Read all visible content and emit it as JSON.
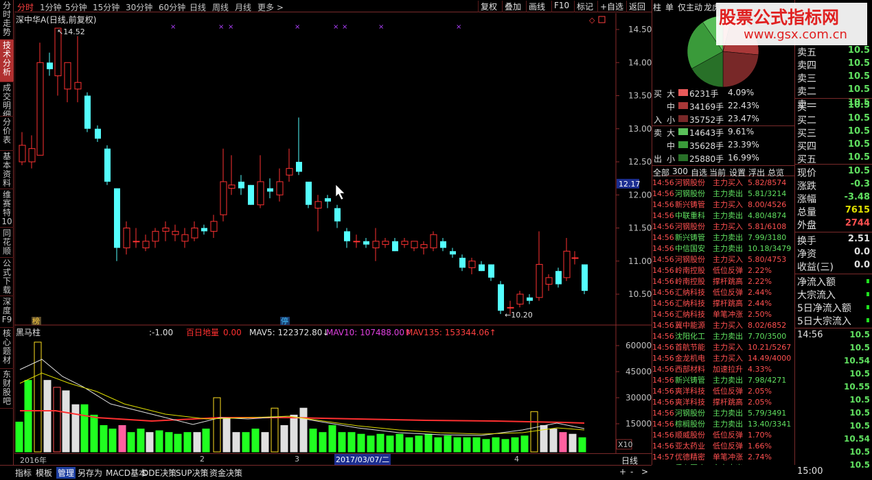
{
  "sidebar": {
    "tabs": [
      {
        "label": "分时走势",
        "active": false
      },
      {
        "label": "技术分析",
        "active": true
      },
      {
        "label": "成交明细",
        "active": false
      },
      {
        "label": "分价表",
        "active": false
      },
      {
        "label": "基本资料",
        "active": false
      },
      {
        "label": "维赛特10",
        "active": false
      },
      {
        "label": "同花顺",
        "active": false
      },
      {
        "label": "公式下载",
        "active": false
      },
      {
        "label": "深度F9",
        "active": false
      },
      {
        "label": "核心题材",
        "active": false
      },
      {
        "label": "东财股吧",
        "active": false
      }
    ]
  },
  "toolbar": {
    "periods": [
      "分时",
      "1分钟",
      "5分钟",
      "15分钟",
      "30分钟",
      "60分钟",
      "日线",
      "周线",
      "月线",
      "更多 >"
    ],
    "active_period": "分时",
    "buttons": [
      "复权",
      "叠加",
      "画线",
      "F10",
      "标记",
      "+自选",
      "返回"
    ],
    "right_tabs": [
      "柱",
      "单",
      "仅主动",
      "龙虎"
    ]
  },
  "main_chart": {
    "title": "深中华A(日线,前复权)",
    "high_label": "14.52",
    "low_label": "←10.20",
    "price_axis": [
      "14.50",
      "14.00",
      "13.50",
      "13.00",
      "12.50",
      "12.00",
      "11.50",
      "11.00",
      "10.50"
    ],
    "current_price_tag": "12.17",
    "badges": {
      "bang": "榜",
      "ting": "停"
    },
    "markers": "×"
  },
  "volume_panel": {
    "indicator_name": "黑马柱",
    "value1": ":-1.00",
    "baidi_label": "百日地量",
    "baidi_value": "0.00",
    "mav5": "MAV5: 122372.80",
    "mav10": "MAV10: 107488.00",
    "mav135": "MAV135: 153344.06",
    "axis": [
      "60000",
      "45000",
      "30000",
      "15000"
    ],
    "axis_unit": "X10"
  },
  "date_axis": {
    "start": "2016年",
    "m2": "2",
    "m3": "3",
    "m4": "4",
    "cursor_date": "2017/03/07/二",
    "period": "日线"
  },
  "bottom_tabs": [
    "指标",
    "模板",
    "管理",
    "另存为",
    "MACD基本",
    "DDE决策",
    "SUP决策",
    "资金决策"
  ],
  "bottom_active": "管理",
  "bottom_controls": [
    "+",
    "-",
    ">"
  ],
  "flow": {
    "buy": [
      {
        "side": "买",
        "size": "大",
        "qty": "6231手",
        "pct": "4.09%",
        "color": "#e85a5a"
      },
      {
        "side": "",
        "size": "中",
        "qty": "34169手",
        "pct": "22.43%",
        "color": "#a83838"
      },
      {
        "side": "入",
        "size": "小",
        "qty": "35752手",
        "pct": "23.47%",
        "color": "#782828"
      }
    ],
    "sell": [
      {
        "side": "卖",
        "size": "大",
        "qty": "14643手",
        "pct": "9.61%",
        "color": "#5ac05a"
      },
      {
        "side": "",
        "size": "中",
        "qty": "35628手",
        "pct": "23.39%",
        "color": "#3a9a3a"
      },
      {
        "side": "出",
        "size": "小",
        "qty": "25880手",
        "pct": "16.99%",
        "color": "#287028"
      }
    ]
  },
  "pie": {
    "slices": [
      4.09,
      22.43,
      23.47,
      16.99,
      23.39,
      9.61
    ],
    "colors": [
      "#e85a5a",
      "#a83838",
      "#782828",
      "#287028",
      "#3a9a3a",
      "#5ac05a"
    ]
  },
  "stream_tabs": [
    "全部",
    "300",
    "自选",
    "当前",
    "设置",
    "浮出",
    "总览"
  ],
  "stream": [
    {
      "time": "14:56",
      "name": "河钢股份",
      "action": "主力买入",
      "info": "5.82/8574",
      "up": true
    },
    {
      "time": "14:56",
      "name": "河钢股份",
      "action": "主力卖出",
      "info": "5.81/3214",
      "up": false
    },
    {
      "time": "14:56",
      "name": "新兴铸管",
      "action": "主力买入",
      "info": "8.00/4526",
      "up": true
    },
    {
      "time": "14:56",
      "name": "中联重科",
      "action": "主力卖出",
      "info": "4.80/4874",
      "up": false
    },
    {
      "time": "14:56",
      "name": "河钢股份",
      "action": "主力买入",
      "info": "5.81/6108",
      "up": true
    },
    {
      "time": "14:56",
      "name": "新兴铸管",
      "action": "主力卖出",
      "info": "7.99/3180",
      "up": false
    },
    {
      "time": "14:56",
      "name": "中信国安",
      "action": "主力卖出",
      "info": "10.18/3479",
      "up": false
    },
    {
      "time": "14:56",
      "name": "河钢股份",
      "action": "主力买入",
      "info": "5.80/4753",
      "up": true
    },
    {
      "time": "14:56",
      "name": "岭南控股",
      "action": "低位反弹",
      "info": "2.22%",
      "up": true
    },
    {
      "time": "14:56",
      "name": "岭南控股",
      "action": "撑杆跳高",
      "info": "2.22%",
      "up": true
    },
    {
      "time": "14:56",
      "name": "汇纳科技",
      "action": "低位反弹",
      "info": "2.44%",
      "up": true
    },
    {
      "time": "14:56",
      "name": "汇纳科技",
      "action": "撑杆跳高",
      "info": "2.44%",
      "up": true
    },
    {
      "time": "14:56",
      "name": "汇纳科技",
      "action": "单笔冲涨",
      "info": "2.50%",
      "up": true
    },
    {
      "time": "14:56",
      "name": "冀中能源",
      "action": "主力买入",
      "info": "8.02/6852",
      "up": true
    },
    {
      "time": "14:56",
      "name": "沈阳化工",
      "action": "主力卖出",
      "info": "7.70/3500",
      "up": false
    },
    {
      "time": "14:56",
      "name": "首航节能",
      "action": "主力买入",
      "info": "10.21/5267",
      "up": true
    },
    {
      "time": "14:56",
      "name": "金龙机电",
      "action": "主力买入",
      "info": "14.49/4000",
      "up": true
    },
    {
      "time": "14:56",
      "name": "西部材料",
      "action": "加速拉升",
      "info": "4.33%",
      "up": true
    },
    {
      "time": "14:56",
      "name": "新兴铸管",
      "action": "主力卖出",
      "info": "7.98/4271",
      "up": false
    },
    {
      "time": "14:56",
      "name": "爽洋科技",
      "action": "低位反弹",
      "info": "2.05%",
      "up": true
    },
    {
      "time": "14:56",
      "name": "爽洋科技",
      "action": "撑杆跳高",
      "info": "2.05%",
      "up": true
    },
    {
      "time": "14:56",
      "name": "河钢股份",
      "action": "主力卖出",
      "info": "5.79/3491",
      "up": false
    },
    {
      "time": "14:56",
      "name": "棕榈股份",
      "action": "主力卖出",
      "info": "13.40/3341",
      "up": false
    },
    {
      "time": "14:56",
      "name": "顺威股份",
      "action": "低位反弹",
      "info": "1.70%",
      "up": true
    },
    {
      "time": "14:56",
      "name": "亚太药业",
      "action": "低位反弹",
      "info": "1.66%",
      "up": true
    },
    {
      "time": "14:57",
      "name": "优德精密",
      "action": "单笔冲涨",
      "info": "2.74%",
      "up": true
    },
    {
      "time": "14:57",
      "name": "乐心医疗",
      "action": "主力卖出",
      "info": "114.79/1860",
      "up": false
    }
  ],
  "quote": {
    "asks": [
      {
        "label": "卖五",
        "val": "10.5"
      },
      {
        "label": "卖四",
        "val": "10.5"
      },
      {
        "label": "卖三",
        "val": "10.5"
      },
      {
        "label": "卖二",
        "val": "10.5"
      },
      {
        "label": "卖一",
        "val": "10.5"
      }
    ],
    "bids": [
      {
        "label": "买一",
        "val": "10.5"
      },
      {
        "label": "买二",
        "val": "10.5"
      },
      {
        "label": "买三",
        "val": "10.5"
      },
      {
        "label": "买四",
        "val": "10.5"
      },
      {
        "label": "买五",
        "val": "10.5"
      }
    ],
    "stats": [
      {
        "label": "现价",
        "val": "10.5",
        "color": "#60e060"
      },
      {
        "label": "涨跌",
        "val": "-0.3",
        "color": "#60e060"
      },
      {
        "label": "涨幅",
        "val": "-3.48",
        "color": "#60e060"
      },
      {
        "label": "总量",
        "val": "7615",
        "color": "#e0e000"
      },
      {
        "label": "外盘",
        "val": "2744",
        "color": "#ff5050"
      },
      {
        "label": "换手",
        "val": "2.51",
        "color": "#e0e0e0"
      },
      {
        "label": "净资",
        "val": "0.0",
        "color": "#e0e0e0"
      },
      {
        "label": "收益(三)",
        "val": "0.0",
        "color": "#e0e0e0"
      }
    ],
    "flow_labels": [
      "净流入额",
      "大宗流入",
      "5日净流入额",
      "5日大宗流入"
    ],
    "ticks_time": "14:56",
    "ticks": [
      "10.5",
      "10.5",
      "10.54",
      "10.5",
      "10.55",
      "10.5",
      "10.5",
      "10.5",
      "10.54",
      "10.5",
      "10.5"
    ],
    "end_time": "15:00"
  },
  "watermark": {
    "title": "股票公式指标网",
    "url": "www.gsx.com.cn"
  }
}
